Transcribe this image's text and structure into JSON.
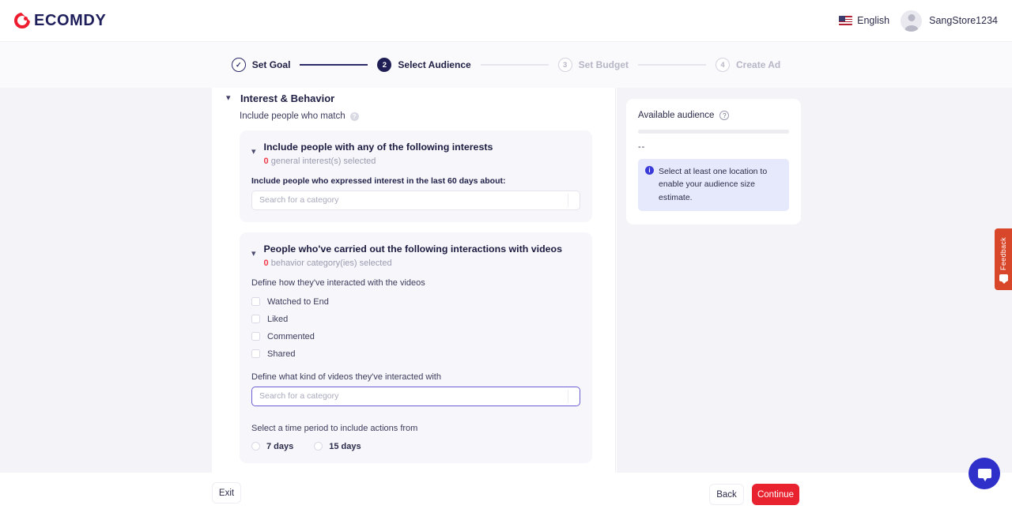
{
  "header": {
    "logo_text": "ECOMDY",
    "language": "English",
    "username": "SangStore1234"
  },
  "stepper": {
    "steps": [
      {
        "num": "✓",
        "label": "Set Goal",
        "state": "done"
      },
      {
        "num": "2",
        "label": "Select Audience",
        "state": "active"
      },
      {
        "num": "3",
        "label": "Set Budget",
        "state": "idle"
      },
      {
        "num": "4",
        "label": "Create Ad",
        "state": "idle"
      }
    ]
  },
  "main": {
    "section_title": "Interest & Behavior",
    "section_sub": "Include people who match",
    "interests_card": {
      "title": "Include people with any of the following interests",
      "count": "0",
      "count_suffix": " general interest(s) selected",
      "field_label": "Include people who expressed interest in the last 60 days about:",
      "search_placeholder": "Search for a category",
      "search_value": ""
    },
    "behavior_card": {
      "title": "People who've carried out the following interactions with videos",
      "count": "0",
      "count_suffix": " behavior category(ies) selected",
      "interaction_label": "Define how they've interacted with the videos",
      "checkboxes": [
        {
          "label": "Watched to End",
          "checked": false
        },
        {
          "label": "Liked",
          "checked": false
        },
        {
          "label": "Commented",
          "checked": false
        },
        {
          "label": "Shared",
          "checked": false
        }
      ],
      "video_kind_label": "Define what kind of videos they've interacted with",
      "search_placeholder": "Search for a category",
      "search_value": "",
      "time_period_label": "Select a time period to include actions from",
      "radios": [
        {
          "label": "7 days",
          "selected": false
        },
        {
          "label": "15 days",
          "selected": false
        }
      ]
    }
  },
  "sidebar": {
    "title": "Available audience",
    "value": "--",
    "notice": "Select at least one location to enable your audience size estimate."
  },
  "footer": {
    "exit_label": "Exit",
    "back_label": "Back",
    "continue_label": "Continue"
  },
  "widgets": {
    "feedback_label": "Feedback"
  },
  "colors": {
    "accent_red": "#e8222e",
    "brand_navy": "#1f1f5c",
    "focus_purple": "#6c5fd4",
    "notice_blue": "#3b3bd9"
  }
}
